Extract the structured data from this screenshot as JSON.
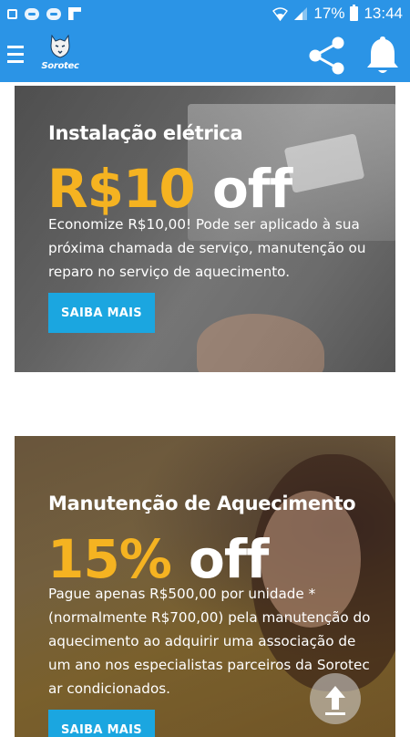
{
  "status_bar": {
    "battery_percent": "17%",
    "time": "13:44",
    "icons": [
      "gallery-icon",
      "message-icon",
      "message-icon",
      "flipboard-icon",
      "wifi-icon",
      "signal-icon",
      "battery-icon"
    ]
  },
  "app_bar": {
    "logo_text": "Sorotec",
    "icons": [
      "menu-icon",
      "share-icon",
      "bell-icon"
    ],
    "color": "#2b94e6"
  },
  "cards": [
    {
      "title": "Instalação elétrica",
      "offer_amount": "R$10",
      "offer_word": "off",
      "description": "Economize R$10,00! Pode ser aplicado à sua próxima chamada de serviço, manutenção ou reparo no serviço de aquecimento.",
      "button_label": "SAIBA MAIS"
    },
    {
      "title": "Manutenção de Aquecimento",
      "offer_amount": "15%",
      "offer_word": "off",
      "description": "Pague apenas R$500,00 por unidade * (normalmente R$700,00) pela manutenção do aquecimento ao adquirir uma associação de um ano nos especialistas parceiros da Sorotec ar condicionados.",
      "button_label": "SAIBA MAIS"
    }
  ],
  "colors": {
    "accent_offer": "#f5b321",
    "button": "#1ba6e0"
  },
  "scroll_top_icon": "arrow-up-icon"
}
